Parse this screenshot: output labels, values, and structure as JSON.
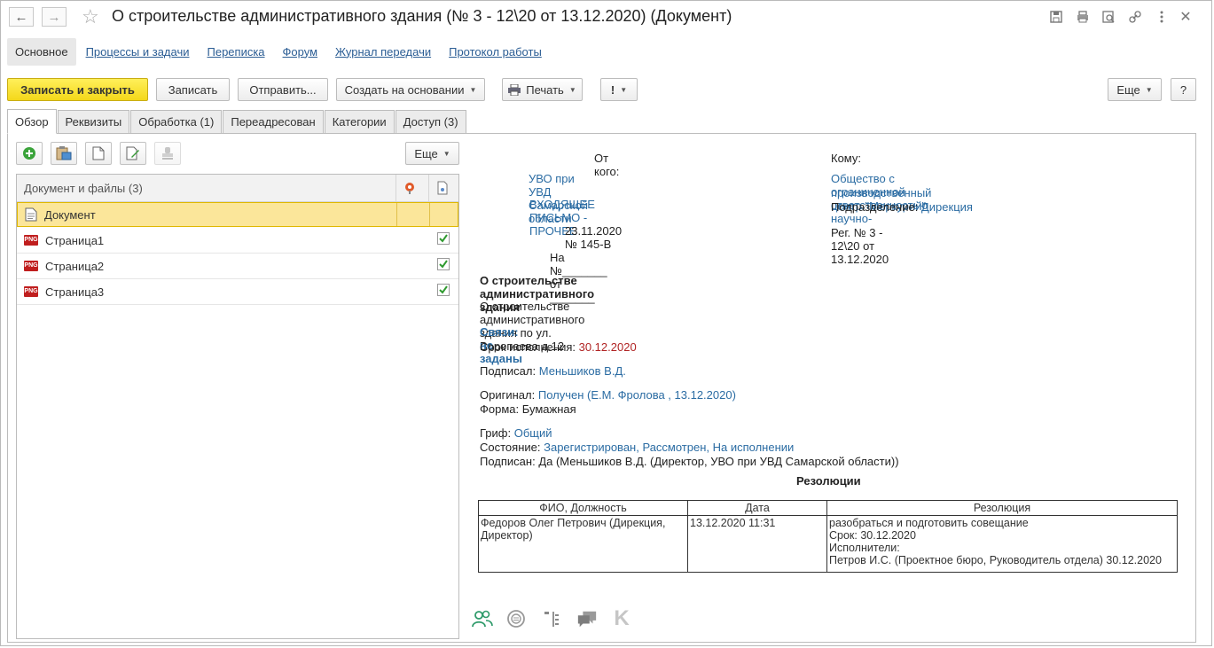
{
  "window": {
    "title": "О строительстве административного здания (№ 3 - 12\\20 от 13.12.2020) (Документ)"
  },
  "sections": {
    "main": "Основное",
    "processes": "Процессы и задачи",
    "correspondence": "Переписка",
    "forum": "Форум",
    "transfer_log": "Журнал передачи",
    "work_log": "Протокол работы"
  },
  "toolbar": {
    "save_close": "Записать и закрыть",
    "save": "Записать",
    "send": "Отправить...",
    "create_based": "Создать на основании",
    "print": "Печать",
    "importance": "!",
    "more": "Еще",
    "help": "?"
  },
  "tabs": {
    "overview": "Обзор",
    "requisites": "Реквизиты",
    "processing": "Обработка (1)",
    "redirected": "Переадресован",
    "categories": "Категории",
    "access": "Доступ (3)"
  },
  "files": {
    "more": "Еще",
    "header": "Документ и файлы (3)",
    "rows": [
      {
        "name": "Документ",
        "icon": "document-icon",
        "checked": false
      },
      {
        "name": "Страница1",
        "icon": "png-icon",
        "checked": true
      },
      {
        "name": "Страница2",
        "icon": "png-icon",
        "checked": true
      },
      {
        "name": "Страница3",
        "icon": "png-icon",
        "checked": true
      }
    ]
  },
  "doc": {
    "from_label": "От кого:",
    "from_org": "УВО при УВД Самарской области",
    "doc_kind": "ВХОДЯЩЕЕ ПИСЬМО - ПРОЧЕЕ",
    "incoming_no": "23.11.2020 № 145-В",
    "ref_line": "На №_______ от _______",
    "to_label": "Кому:",
    "to_org_line1": "Общество с ограниченной ответственностью научно-",
    "to_org_line2": "производственный центр \"Меркурий\"",
    "division_label": "Подразделение:",
    "division": "Дирекция",
    "reg_line": "Рег. № 3 - 12\\20 от 13.12.2020",
    "subject": "О строительстве административного здания",
    "content": "О строительстве административного здания по ул. Воропаева д.12",
    "links": "Связи: не заданы",
    "deadline_label": "Срок исполнения:",
    "deadline": "30.12.2020",
    "signed_by_label": "Подписал:",
    "signed_by": "Меньшиков В.Д.",
    "original_label": "Оригинал:",
    "original": "Получен (Е.М. Фролова , 13.12.2020)",
    "form_label": "Форма:",
    "form": "Бумажная",
    "stamp_label": "Гриф:",
    "stamp": "Общий",
    "state_label": "Состояние:",
    "state": "Зарегистрирован, Рассмотрен, На исполнении",
    "signed_label": "Подписан:",
    "signed": "Да (Меньшиков В.Д. (Директор, УВО при УВД Самарской области))",
    "resolutions_title": "Резолюции"
  },
  "resolutions": {
    "headers": [
      "ФИО, Должность",
      "Дата",
      "Резолюция"
    ],
    "row": {
      "person_line1": "Федоров Олег Петрович (Дирекция,",
      "person_line2": "Директор)",
      "date": "13.12.2020 11:31",
      "res_line1": "разобраться и подготовить совещание",
      "res_line2": "Срок: 30.12.2020",
      "res_line3": "Исполнители:",
      "res_line4": "Петров И.С. (Проектное бюро, Руководитель отдела) 30.12.2020"
    }
  },
  "colors": {
    "primary_button": "#f4d81a",
    "link": "#2b6ca3",
    "selected_row": "#fbe69a",
    "deadline": "#b02323"
  }
}
